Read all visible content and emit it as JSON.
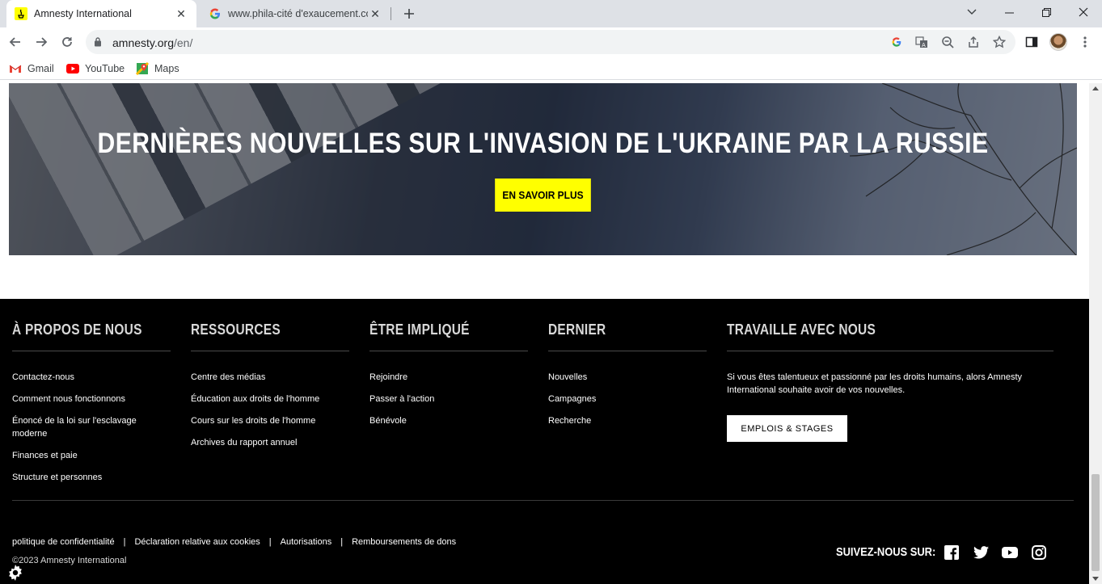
{
  "browser": {
    "tabs": [
      {
        "title": "Amnesty International",
        "active": true
      },
      {
        "title": "www.phila-cité d'exaucement.com",
        "active": false
      }
    ],
    "url": {
      "host": "amnesty.org",
      "path": "/en/"
    },
    "bookmarks": [
      "Gmail",
      "YouTube",
      "Maps"
    ]
  },
  "hero": {
    "heading": "DERNIÈRES NOUVELLES SUR L'INVASION DE L'UKRAINE PAR LA RUSSIE",
    "cta": "EN SAVOIR PLUS"
  },
  "footer": {
    "columns": [
      {
        "title": "À PROPOS DE NOUS",
        "links": [
          "Contactez-nous",
          "Comment nous fonctionnons",
          "Énoncé de la loi sur l'esclavage moderne",
          "Finances et paie",
          "Structure et personnes"
        ]
      },
      {
        "title": "RESSOURCES",
        "links": [
          "Centre des médias",
          "Éducation aux droits de l'homme",
          "Cours sur les droits de l'homme",
          "Archives du rapport annuel"
        ]
      },
      {
        "title": "ÊTRE IMPLIQUÉ",
        "links": [
          "Rejoindre",
          "Passer à l'action",
          "Bénévole"
        ]
      },
      {
        "title": "DERNIER",
        "links": [
          "Nouvelles",
          "Campagnes",
          "Recherche"
        ]
      }
    ],
    "work": {
      "title": "TRAVAILLE AVEC NOUS",
      "text": "Si vous êtes talentueux et passionné par les droits humains, alors Amnesty International souhaite avoir de vos nouvelles.",
      "button": "EMPLOIS & STAGES"
    },
    "legal": [
      "politique de confidentialité",
      "Déclaration relative aux cookies",
      "Autorisations",
      "Remboursements de dons"
    ],
    "legal_separator": "|",
    "copyright": "©2023 Amnesty International",
    "follow": "SUIVEZ-NOUS SUR:",
    "social_icons": [
      "facebook-icon",
      "twitter-icon",
      "youtube-icon",
      "instagram-icon"
    ]
  },
  "colors": {
    "accent": "#ffff00",
    "footer_bg": "#000000"
  }
}
